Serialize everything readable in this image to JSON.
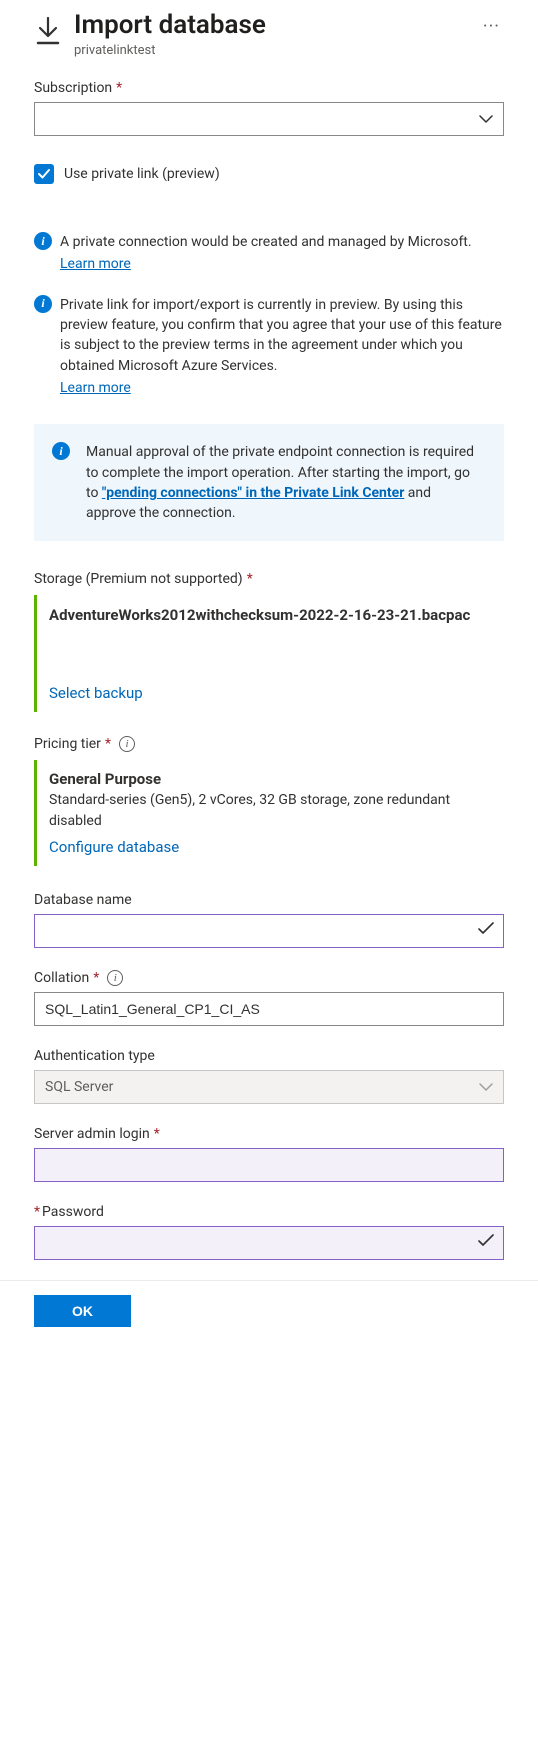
{
  "header": {
    "title": "Import database",
    "subtitle": "privatelinktest"
  },
  "subscription": {
    "label": "Subscription",
    "value": ""
  },
  "checkbox": {
    "label": "Use private link (preview)",
    "checked": true
  },
  "info1": {
    "text": "A private connection would be created and managed by Microsoft.",
    "learn": "Learn more"
  },
  "info2": {
    "text": "Private link for import/export is currently in preview. By using this preview feature, you confirm that you agree that your use of this feature is subject to the preview terms in the agreement under which you obtained Microsoft Azure Services.",
    "learn": "Learn more"
  },
  "callout": {
    "pre": "Manual approval of the private endpoint connection is required to complete the import operation. After starting the import, go to ",
    "link": "\"pending connections\" in the Private Link Center",
    "post": " and approve the connection."
  },
  "storage": {
    "label": "Storage (Premium not supported)",
    "filename": "AdventureWorks2012withchecksum-2022-2-16-23-21.bacpac",
    "action": "Select backup"
  },
  "pricing": {
    "label": "Pricing tier",
    "title": "General Purpose",
    "desc": "Standard-series (Gen5), 2 vCores, 32 GB storage, zone redundant disabled",
    "action": "Configure database"
  },
  "dbname": {
    "label": "Database name",
    "value": ""
  },
  "collation": {
    "label": "Collation",
    "value": "SQL_Latin1_General_CP1_CI_AS"
  },
  "authtype": {
    "label": "Authentication type",
    "value": "SQL Server"
  },
  "adminlogin": {
    "label": "Server admin login",
    "value": ""
  },
  "password": {
    "label": "Password",
    "value": ""
  },
  "footer": {
    "ok": "OK"
  },
  "icons": {
    "info": "i"
  }
}
